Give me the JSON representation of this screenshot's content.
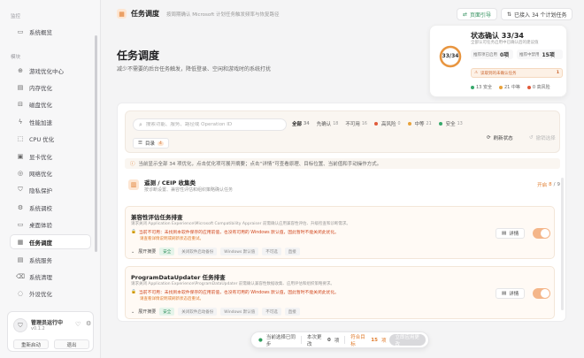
{
  "sidebar": {
    "sections": [
      {
        "label": "监控",
        "items": [
          {
            "label": "系统概览",
            "icon": "monitor-icon"
          }
        ]
      },
      {
        "label": "模块",
        "items": [
          {
            "label": "游戏优化中心",
            "icon": "gamepad-icon"
          },
          {
            "label": "内存优化",
            "icon": "memory-icon"
          },
          {
            "label": "磁盘优化",
            "icon": "disk-icon"
          },
          {
            "label": "性能加速",
            "icon": "lightning-icon"
          },
          {
            "label": "CPU 优化",
            "icon": "cpu-icon"
          },
          {
            "label": "显卡优化",
            "icon": "gpu-icon"
          },
          {
            "label": "网络优化",
            "icon": "network-icon"
          },
          {
            "label": "隐私保护",
            "icon": "shield-icon"
          },
          {
            "label": "系统调校",
            "icon": "tune-icon"
          },
          {
            "label": "桌面体验",
            "icon": "desktop-icon"
          },
          {
            "label": "任务调度",
            "icon": "schedule-icon",
            "active": true
          },
          {
            "label": "系统服务",
            "icon": "service-icon"
          },
          {
            "label": "系统清理",
            "icon": "clean-icon"
          },
          {
            "label": "外设优化",
            "icon": "peripheral-icon"
          }
        ]
      }
    ],
    "footer": {
      "status": "管理员运行中",
      "version": "v0.1.2",
      "restart": "重新启动",
      "exit": "退出"
    }
  },
  "topbar": {
    "title": "任务调度",
    "subtitle": "按周期确认 Microsoft 计划任务触发频率与恢复路径",
    "guide_label": "页面引导",
    "plan_label": "已接入 34 个计划任务"
  },
  "hero": {
    "title": "任务调度",
    "subtitle": "减少不需要的后台任务触发，降低登录、空闲和游戏时的系统打扰"
  },
  "status_card": {
    "title": "状态确认 33/34",
    "subtitle": "全部认可任务启用中已确认后的建议值",
    "ring_label": "33/34",
    "ring_fraction": 0.97,
    "stats": [
      {
        "label": "推荐项已启用",
        "value": "0项"
      },
      {
        "label": "推荐中禁用",
        "value": "15项"
      }
    ],
    "warning_text": "读取到的未确认任务",
    "warning_count": "1",
    "legend": [
      {
        "label": "13 安全",
        "color": "#36a86b"
      },
      {
        "label": "21 中等",
        "color": "#e8a23a"
      },
      {
        "label": "0 高风险",
        "color": "#e05a3a"
      }
    ]
  },
  "filters": {
    "search_placeholder": "搜索功能、服务、路径或 Operation ID",
    "chips": [
      {
        "label": "全部",
        "count": "34",
        "active": true
      },
      {
        "label": "先确认",
        "count": "18"
      },
      {
        "label": "不可用",
        "count": "16"
      },
      {
        "label": "高风险",
        "count": "0",
        "dot": "#e05a3a"
      },
      {
        "label": "中等",
        "count": "21",
        "dot": "#e8a23a"
      },
      {
        "label": "安全",
        "count": "13",
        "dot": "#36a86b"
      }
    ],
    "dir_label": "目录",
    "dir_count": "4",
    "refresh_label": "刷新状态",
    "undo_label": "撤销选择"
  },
  "info_text": "当前显示全部 34 项优化，点击优化项可展开摘要；点击“详情”可查看原理、目标位置、当前值和手动操作方式。",
  "group": {
    "title": "遥测 / CEIP 收集类",
    "subtitle": "按诊断设置、兼容性评估和组织策略确认任务",
    "count_on": "开启",
    "count_on_n": "8",
    "count_total": "9"
  },
  "tasks": [
    {
      "name": "兼容性评估任务排查",
      "desc": "请求关闭 Application Experience\\Microsoft Compatibility Appraiser 前需确认应用兼容性评估、升级检查和诊断需求。",
      "warning": "当前不可用：未找到本软件保存的应用前值，也没有可用的 Windows 默认值，因此暂时不能关闭此优化。",
      "link": "请查看详情说明或刷新状态后重试。",
      "expand": "展开摘要",
      "tags": [
        "安全",
        "关闭软件启动备份",
        "Windows 默认值",
        "不可选",
        "直接"
      ],
      "detail": "详情",
      "enabled": true
    },
    {
      "name": "ProgramDataUpdater 任务排查",
      "desc": "请求关闭 Application Experience\\ProgramDataUpdater 前需确认兼容性数据收集、应用评估和组织策略要求。",
      "warning": "当前不可用：未找到本软件保存的应用前值，也没有可用的 Windows 默认值，因此暂时不能关闭此优化。",
      "link": "请查看详情说明或刷新状态后重试。",
      "expand": "展开摘要",
      "tags": [
        "安全",
        "关闭软件启动备份",
        "Windows 默认值",
        "不可选",
        "直接"
      ],
      "detail": "详情",
      "enabled": true
    }
  ],
  "bottombar": {
    "status": "当前选择已同步",
    "changes_label": "本次更改",
    "changes_n": "0",
    "changes_unit": "项",
    "pending_label": "符合目标",
    "pending_n": "15",
    "pending_unit": "项",
    "apply_label": "立即应用更改"
  },
  "colors": {
    "accent": "#e07a2b",
    "safe": "#36a86b",
    "warn": "#e8a23a",
    "danger": "#e05a3a"
  }
}
